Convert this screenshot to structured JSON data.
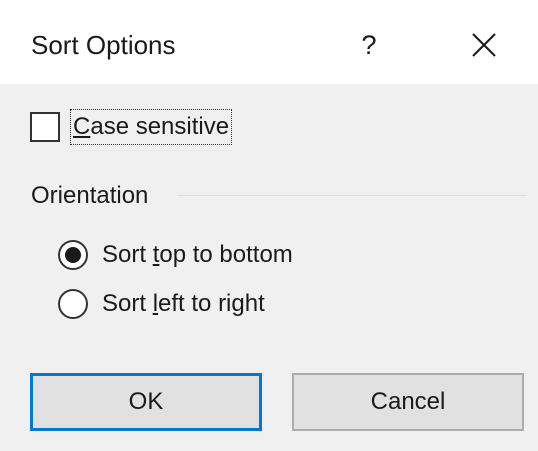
{
  "dialog": {
    "title": "Sort Options",
    "help_label": "?",
    "close_icon": "close-icon"
  },
  "case_sensitive": {
    "label_prefix": "C",
    "label_rest": "ase sensitive",
    "checked": false
  },
  "orientation": {
    "group_label": "Orientation",
    "options": [
      {
        "label_before": "Sort ",
        "access_key": "t",
        "label_after": "op to bottom",
        "selected": true
      },
      {
        "label_before": "Sort ",
        "access_key": "l",
        "label_after": "eft to right",
        "selected": false
      }
    ]
  },
  "buttons": {
    "ok_label": "OK",
    "cancel_label": "Cancel"
  },
  "colors": {
    "accent": "#0078d7",
    "dialog_background": "#f0f0f0",
    "titlebar_background": "#ffffff"
  }
}
